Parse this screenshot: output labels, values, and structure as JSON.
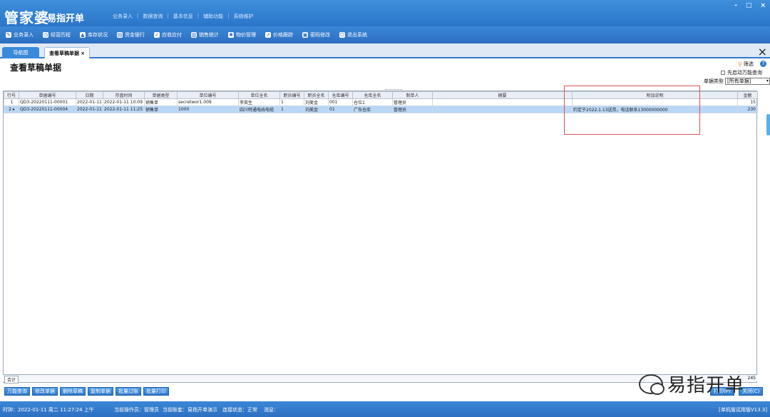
{
  "app": {
    "logo_main": "管家婆",
    "logo_sub": "易指开单",
    "top_menu": [
      "业务录入",
      "数据查询",
      "基本信息",
      "辅助功能",
      "系统维护"
    ],
    "window_controls": [
      "-",
      "□",
      "×"
    ]
  },
  "toolbar": [
    {
      "label": "业务录入",
      "icon": "edit-icon"
    },
    {
      "label": "经营历程",
      "icon": "history-icon"
    },
    {
      "label": "库存状况",
      "icon": "stock-icon"
    },
    {
      "label": "资金银行",
      "icon": "bank-icon"
    },
    {
      "label": "应收应付",
      "icon": "receivable-icon"
    },
    {
      "label": "销售统计",
      "icon": "chart-icon"
    },
    {
      "label": "物价管理",
      "icon": "gear-icon"
    },
    {
      "label": "价格跟踪",
      "icon": "pin-icon"
    },
    {
      "label": "密码修改",
      "icon": "key-icon"
    },
    {
      "label": "退出系统",
      "icon": "power-icon"
    }
  ],
  "tabs": {
    "nav": "导航图",
    "active": "查看草稿单据",
    "active_close": "×",
    "window_close": "×"
  },
  "page": {
    "title": "查看草稿单据",
    "filter_label": "筛选",
    "help_icon_text": "?",
    "checkbox_label": "先启动万能查询",
    "doc_type_label": "单据类型",
    "doc_type_value": "[所有单据]",
    "dropdown_glyph": "▾"
  },
  "table": {
    "columns": [
      "行号",
      "单据编号",
      "日期",
      "存盘时间",
      "单据类型",
      "单位编号",
      "单位全名",
      "职员编号",
      "职员全名",
      "仓库编号",
      "仓库全名",
      "制单人",
      "摘要",
      "附加说明",
      "金额"
    ],
    "rows": [
      {
        "row": "1",
        "marker": "",
        "no": "QD3-20220111-00001",
        "date": "2022-01-11",
        "saved": "2022-01-11 10:09",
        "type": "销售单",
        "unit_no": "secretwor1.009",
        "unit_name": "李英生",
        "emp_no": "1",
        "emp_name": "刘美金",
        "wh_no": "001",
        "wh_name": "仓位1",
        "maker": "管理员",
        "summary": "",
        "note": "",
        "amount": "15",
        "selected": false
      },
      {
        "row": "2",
        "marker": "▸",
        "no": "QD3-20220111-00004",
        "date": "2022-01-11",
        "saved": "2022-01-11 11:25",
        "type": "销售单",
        "unit_no": "1000",
        "unit_name": "四川特通电线电缆",
        "emp_no": "1",
        "emp_name": "刘美金",
        "wh_no": "01",
        "wh_name": "广东仓库",
        "maker": "管理员",
        "summary": "",
        "note": "约定于2022.1.13送货，电话联系13000000000",
        "amount": "230",
        "selected": true
      }
    ],
    "footer_label": "合计",
    "footer_total": "245"
  },
  "buttons": [
    "万能查询",
    "修改单据",
    "删除草稿",
    "复制单据",
    "批量过账",
    "批量打印"
  ],
  "right_buttons": [
    "打印(P)",
    "关闭(C)"
  ],
  "watermark": "易指开单",
  "status": {
    "time": "时钟：2022-01-11 周二 11:27:24 上午",
    "operator": "当前操作员：管理员",
    "account": "当前账套：易指开单演示",
    "conn": "连接状态：正常",
    "msg": "消息：",
    "version": "[单机版试用版V13.3]"
  }
}
